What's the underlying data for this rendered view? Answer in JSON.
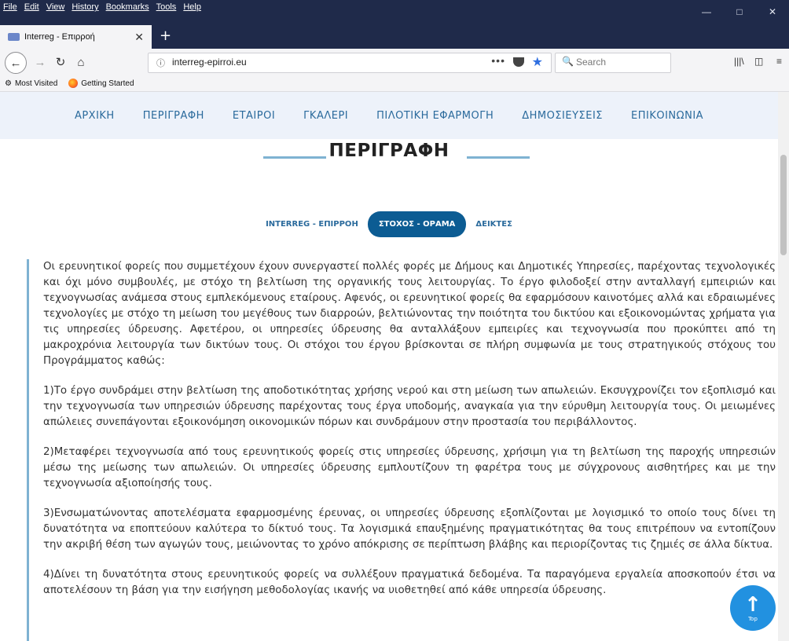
{
  "menubar": {
    "items": [
      "File",
      "Edit",
      "View",
      "History",
      "Bookmarks",
      "Tools",
      "Help"
    ],
    "controls": [
      "minimize-icon",
      "maximize-icon",
      "close-icon"
    ]
  },
  "tabs": [
    {
      "title": "Interreg - Επιρροή",
      "active": true
    }
  ],
  "newtab": "+",
  "navbar": {
    "url": "interreg-epirroi.eu",
    "search_placeholder": "Search",
    "dots": "•••"
  },
  "bookmarks": [
    {
      "label": "Most Visited",
      "icon": "gear-icon"
    },
    {
      "label": "Getting Started",
      "icon": "firefox-icon"
    }
  ],
  "site_nav": [
    "ΑΡΧΙΚΗ",
    "ΠΕΡΙΓΡΑΦΗ",
    "ΕΤΑΙΡΟΙ",
    "ΓΚΑΛΕΡΙ",
    "ΠΙΛΟΤΙΚΗ ΕΦΑΡΜΟΓΗ",
    "ΔΗΜΟΣΙΕΥΣΕΙΣ",
    "ΕΠΙΚΟΙΝΩΝΙΑ"
  ],
  "page_title": "ΠΕΡΙΓΡΑΦΗ",
  "subtabs": [
    {
      "label": "INTERREG - ΕΠΙΡΡΟΗ",
      "active": false
    },
    {
      "label": "ΣΤΟΧΟΣ - ΟΡΑΜΑ",
      "active": true
    },
    {
      "label": "ΔΕΙΚΤΕΣ",
      "active": false
    }
  ],
  "paragraphs": [
    "Οι ερευνητικοί φορείς που συμμετέχουν έχουν συνεργαστεί πολλές φορές με Δήμους και Δημοτικές Υπηρεσίες, παρέχοντας τεχνολογικές και όχι μόνο συμβουλές, με στόχο τη βελτίωση της οργανικής τους λειτουργίας. Το έργο φιλοδοξεί στην ανταλλαγή εμπειριών και τεχνογνωσίας ανάμεσα στους εμπλεκόμενους εταίρους. Αφενός, οι ερευνητικοί φορείς θα εφαρμόσουν καινοτόμες αλλά και εδραιωμένες τεχνολογίες με στόχο τη μείωση του μεγέθους των διαρροών, βελτιώνοντας την ποιότητα του δικτύου και εξοικονομώντας χρήματα για τις υπηρεσίες ύδρευσης. Αφετέρου, οι υπηρεσίες ύδρευσης θα ανταλλάξουν εμπειρίες και τεχνογνωσία που προκύπτει από τη μακροχρόνια λειτουργία των δικτύων τους. Οι στόχοι του έργου βρίσκονται σε πλήρη συμφωνία με τους στρατηγικούς στόχους του Προγράμματος καθώς:",
    "1)Το έργο συνδράμει στην βελτίωση της αποδοτικότητας χρήσης νερού και στη μείωση των απωλειών. Εκσυγχρονίζει τον εξοπλισμό και την τεχνογνωσία των υπηρεσιών ύδρευσης παρέχοντας τους έργα υποδομής, αναγκαία για την εύρυθμη λειτουργία τους. Οι μειωμένες απώλειες συνεπάγονται εξοικονόμηση οικονομικών πόρων και συνδράμουν στην προστασία του περιβάλλοντος.",
    "2)Μεταφέρει τεχνογνωσία από τους ερευνητικούς φορείς στις υπηρεσίες ύδρευσης, χρήσιμη για τη βελτίωση της παροχής υπηρεσιών μέσω της μείωσης των απωλειών. Οι υπηρεσίες ύδρευσης εμπλουτίζουν τη φαρέτρα τους με σύγχρονους αισθητήρες και με την τεχνογνωσία αξιοποίησής τους.",
    "3)Ενσωματώνοντας αποτελέσματα εφαρμοσμένης έρευνας, οι υπηρεσίες ύδρευσης εξοπλίζονται με λογισμικό το οποίο τους δίνει τη δυνατότητα να εποπτεύουν καλύτερα το δίκτυό τους. Τα λογισμικά επαυξημένης πραγματικότητας θα τους επιτρέπουν να εντοπίζουν την ακριβή θέση των αγωγών τους, μειώνοντας το χρόνο απόκρισης σε περίπτωση βλάβης και περιορίζοντας τις ζημιές σε άλλα δίκτυα.",
    "4)Δίνει τη δυνατότητα στους ερευνητικούς φορείς να συλλέξουν πραγματικά δεδομένα. Τα παραγόμενα εργαλεία αποσκοπούν έτσι να αποτελέσουν τη βάση για την εισήγηση μεθοδολογίας ικανής να υιοθετηθεί από κάθε υπηρεσία ύδρευσης."
  ],
  "top_button": {
    "arrow": "↑",
    "label": "Top"
  },
  "colors": {
    "accent": "#0c5c93",
    "link": "#2a6a9c",
    "line": "#7fb2d2",
    "top": "#2291e0"
  }
}
